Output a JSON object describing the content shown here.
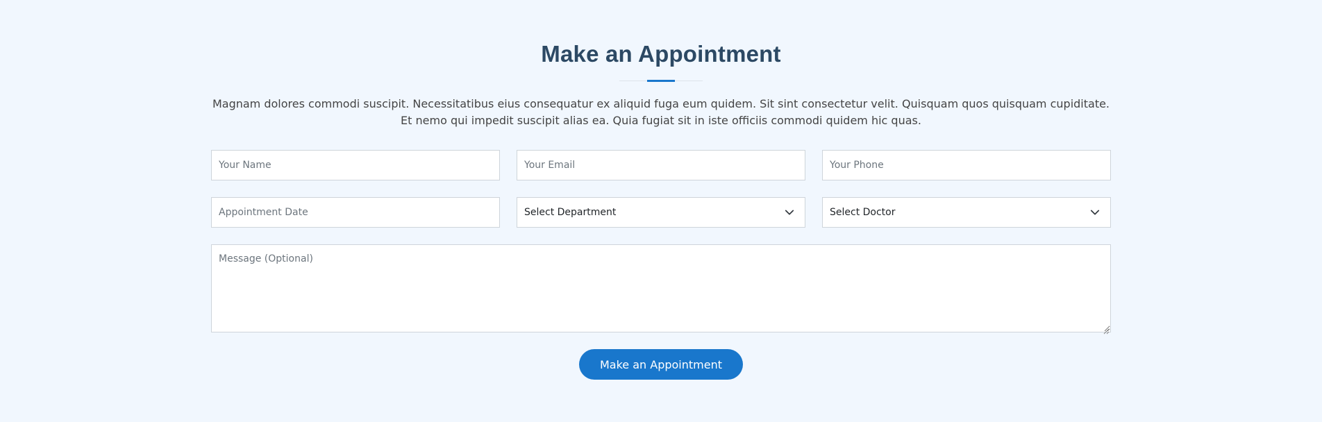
{
  "section": {
    "title": "Make an Appointment",
    "description": "Magnam dolores commodi suscipit. Necessitatibus eius consequatur ex aliquid fuga eum quidem. Sit sint consectetur velit. Quisquam quos quisquam cupiditate. Et nemo qui impedit suscipit alias ea. Quia fugiat sit in iste officiis commodi quidem hic quas."
  },
  "form": {
    "name": {
      "placeholder": "Your Name",
      "value": ""
    },
    "email": {
      "placeholder": "Your Email",
      "value": ""
    },
    "phone": {
      "placeholder": "Your Phone",
      "value": ""
    },
    "date": {
      "placeholder": "Appointment Date",
      "value": ""
    },
    "department": {
      "selected": "Select Department",
      "icon": "chevron-down-icon"
    },
    "doctor": {
      "selected": "Select Doctor",
      "icon": "chevron-down-icon"
    },
    "message": {
      "placeholder": "Message (Optional)",
      "value": ""
    },
    "submit_label": "Make an Appointment"
  },
  "colors": {
    "background": "#f1f7fe",
    "heading": "#2c4964",
    "accent": "#1977cc",
    "text": "#444444",
    "border": "#ced4da"
  }
}
